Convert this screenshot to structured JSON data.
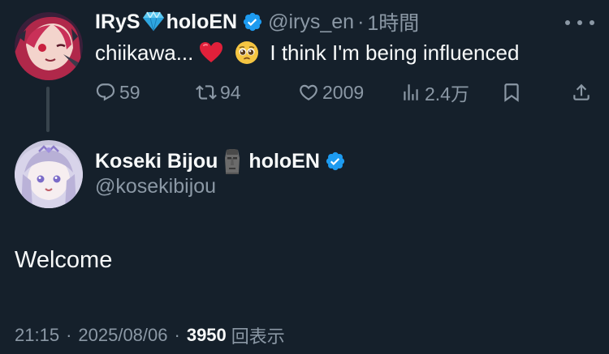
{
  "parent_tweet": {
    "display_name": "IRyS",
    "name_suffix": "holoEN",
    "handle": "@irys_en",
    "separator": "·",
    "time": "1時間",
    "text_prefix": "chiikawa...",
    "text_suffix": "I think I'm being influenced",
    "emoji_1": "red-heart",
    "emoji_2": "pleading-face",
    "stats": {
      "replies": "59",
      "retweets": "94",
      "likes": "2009",
      "views": "2.4万"
    }
  },
  "reply_tweet": {
    "display_name": "Koseki Bijou",
    "name_suffix": "holoEN",
    "handle": "@kosekibijou",
    "text": "Welcome",
    "time": "21:15",
    "date": "2025/08/06",
    "separator": "·",
    "views_count": "3950",
    "views_label": "回表示"
  },
  "colors": {
    "background": "#15202b",
    "text_primary": "#f7f9f9",
    "text_secondary": "#8b98a5",
    "verified": "#1d9bf0",
    "thread_line": "#38444d"
  }
}
